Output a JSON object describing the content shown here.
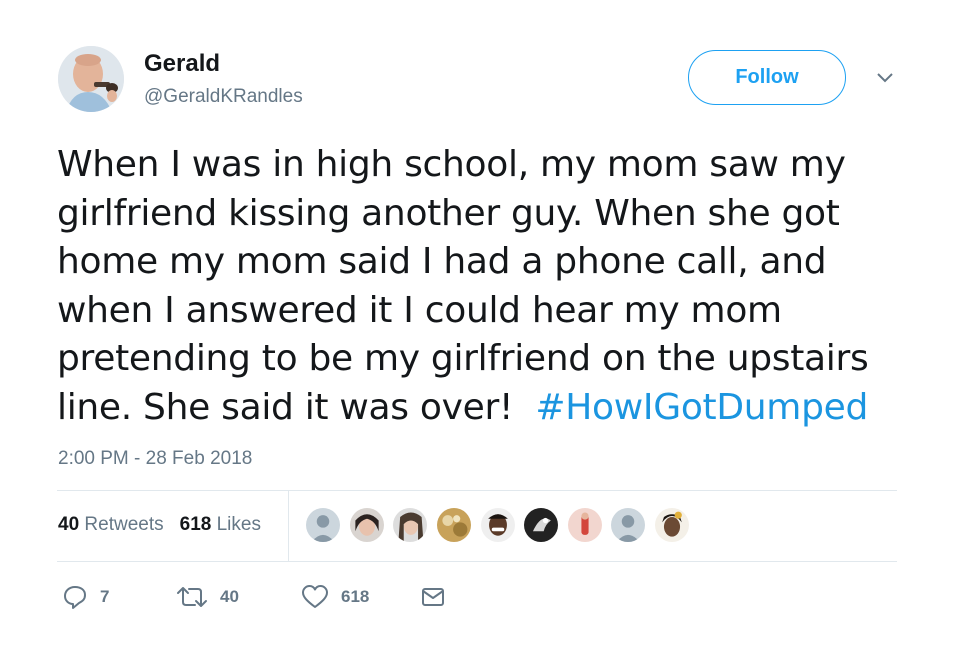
{
  "author": {
    "name": "Gerald",
    "handle": "@GeraldKRandles"
  },
  "follow_label": "Follow",
  "tweet": {
    "lines": [
      "When I was in high school, my mom saw my",
      "girlfriend kissing another guy. When she got",
      "home my mom said I had a phone call, and",
      "when I answered it I could hear my mom",
      "pretending to be my girlfriend on the upstairs"
    ],
    "last_line": "line. She said it was over!",
    "hashtag": "#HowIGotDumped",
    "timestamp": "2:00 PM - 28 Feb 2018"
  },
  "stats": {
    "retweets_count": "40",
    "retweets_label": "Retweets",
    "likes_count": "618",
    "likes_label": "Likes"
  },
  "actions": {
    "reply_count": "7",
    "retweet_count": "40",
    "like_count": "618"
  },
  "colors": {
    "accent": "#1da1f2",
    "hashtag": "#1b95e0",
    "muted": "#657786",
    "text": "#14171a",
    "border": "#e1e8ed"
  },
  "icons": [
    "chevron-down-icon",
    "reply-icon",
    "retweet-icon",
    "heart-icon",
    "envelope-icon"
  ]
}
